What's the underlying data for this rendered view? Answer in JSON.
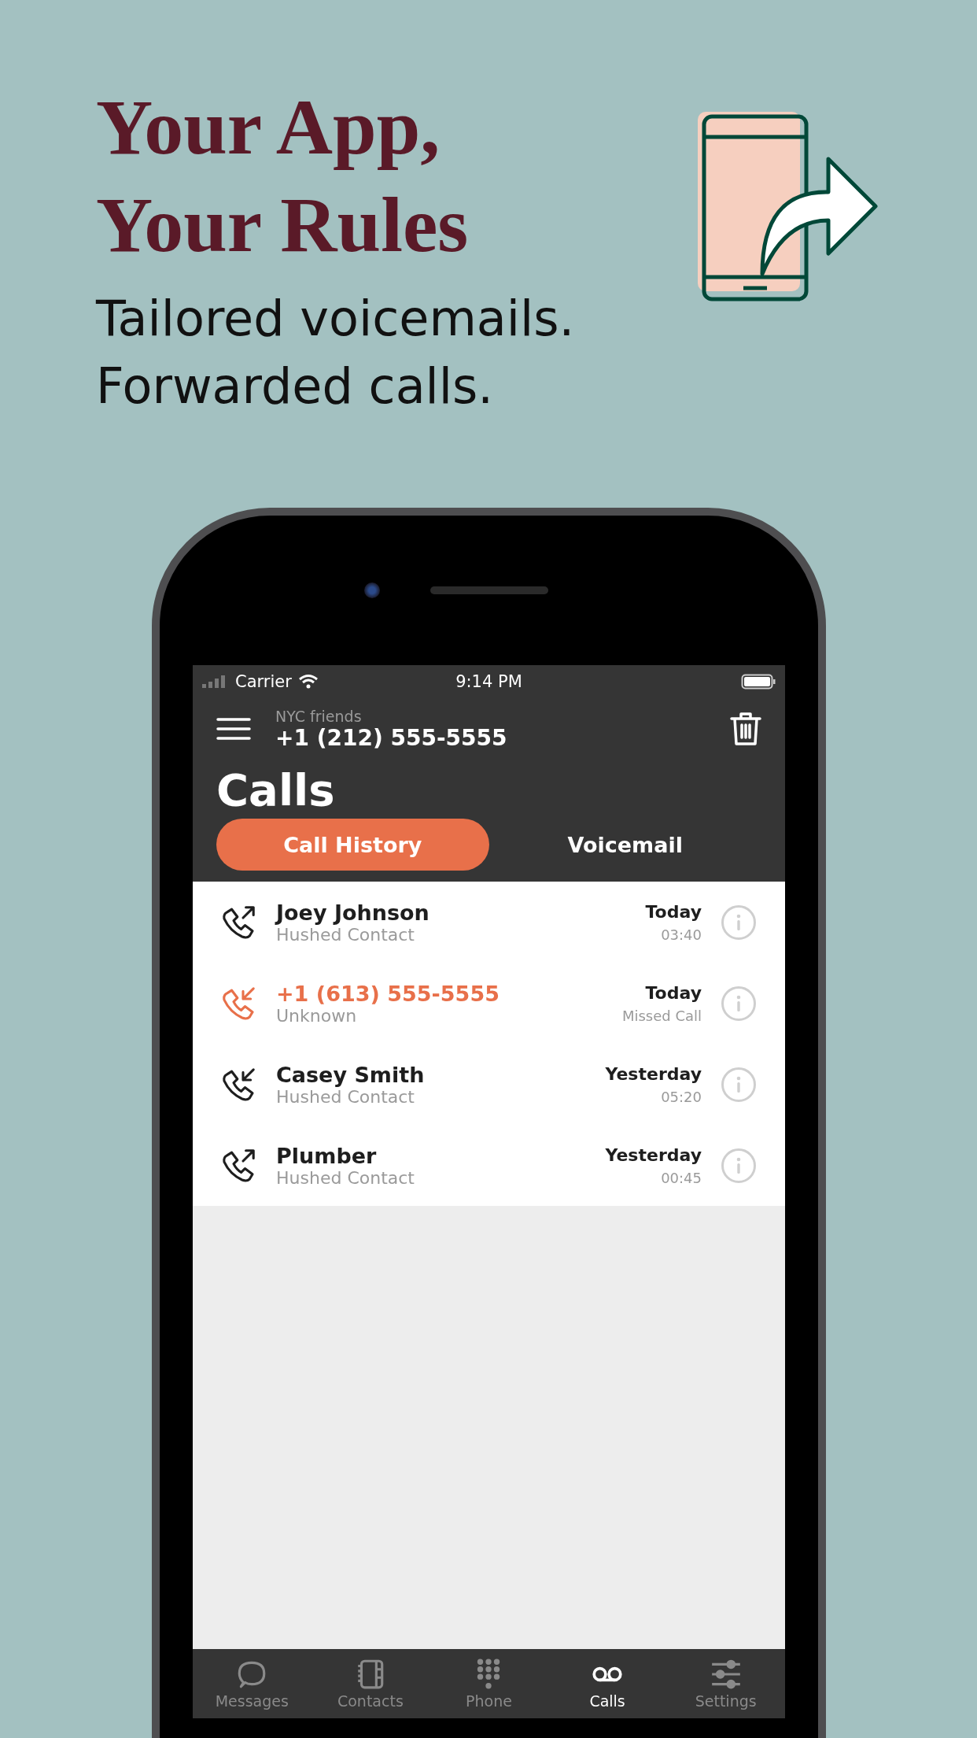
{
  "headline": {
    "title_lines": [
      "Your App,",
      "Your Rules"
    ],
    "subtitle_lines": [
      "Tailored voicemails.",
      "Forwarded calls."
    ]
  },
  "status_bar": {
    "carrier": "Carrier",
    "time": "9:14 PM"
  },
  "header": {
    "account_label": "NYC friends",
    "account_number": "+1 (212) 555-5555",
    "title": "Calls"
  },
  "segments": [
    {
      "label": "Call History",
      "selected": true
    },
    {
      "label": "Voicemail",
      "selected": false
    }
  ],
  "calls": [
    {
      "name": "Joey Johnson",
      "subtitle": "Hushed Contact",
      "date": "Today",
      "detail": "03:40",
      "kind": "outgoing",
      "missed": false
    },
    {
      "name": "+1 (613) 555-5555",
      "subtitle": "Unknown",
      "date": "Today",
      "detail": "Missed Call",
      "kind": "incoming",
      "missed": true
    },
    {
      "name": "Casey Smith",
      "subtitle": "Hushed Contact",
      "date": "Yesterday",
      "detail": "05:20",
      "kind": "incoming",
      "missed": false
    },
    {
      "name": "Plumber",
      "subtitle": "Hushed Contact",
      "date": "Yesterday",
      "detail": "00:45",
      "kind": "outgoing",
      "missed": false
    }
  ],
  "tab_bar": [
    {
      "label": "Messages",
      "kind": "chat",
      "selected": false
    },
    {
      "label": "Contacts",
      "kind": "notebook",
      "selected": false
    },
    {
      "label": "Phone",
      "kind": "keypad",
      "selected": false
    },
    {
      "label": "Calls",
      "kind": "voicemail",
      "selected": true
    },
    {
      "label": "Settings",
      "kind": "sliders",
      "selected": false
    }
  ]
}
